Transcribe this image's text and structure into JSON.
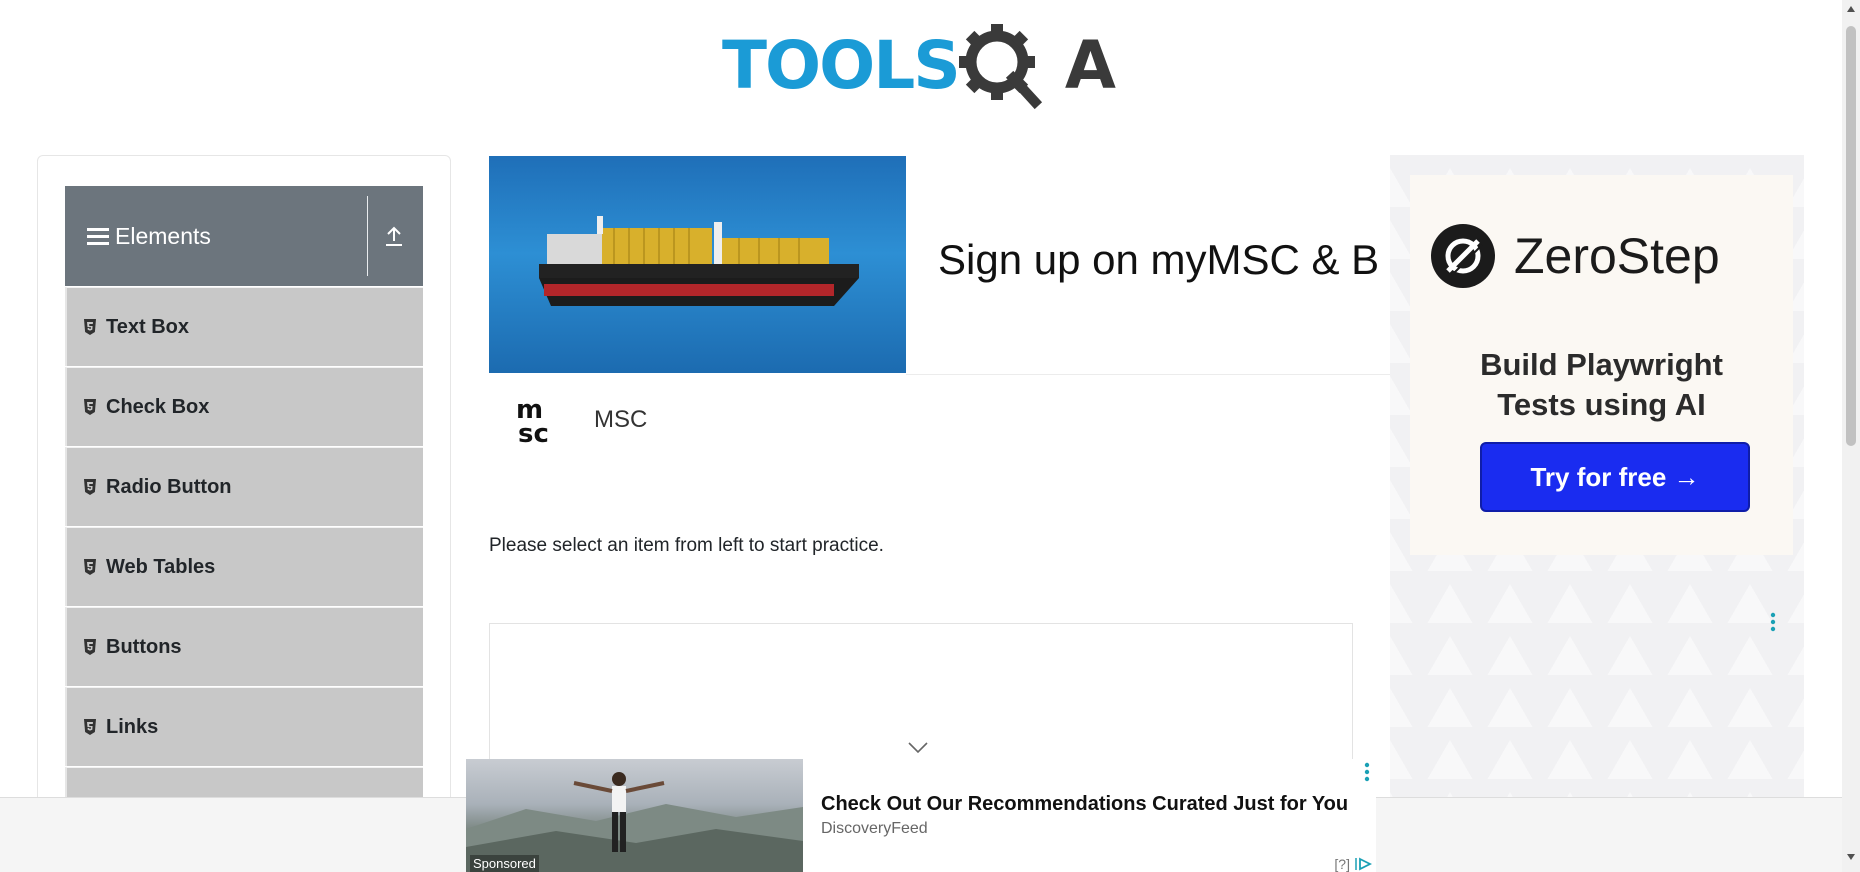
{
  "header": {
    "logo_text": "TOOLS",
    "logo_suffix": "A"
  },
  "sidebar": {
    "group_title": "Elements",
    "items": [
      {
        "label": "Text Box"
      },
      {
        "label": "Check Box"
      },
      {
        "label": "Radio Button"
      },
      {
        "label": "Web Tables"
      },
      {
        "label": "Buttons"
      },
      {
        "label": "Links"
      }
    ]
  },
  "top_ad": {
    "title": "Sign up on myMSC & B",
    "advertiser": "MSC"
  },
  "main": {
    "instruction": "Please select an item from left to start practice."
  },
  "right_ad": {
    "brand": "ZeroStep",
    "tagline_line1": "Build Playwright",
    "tagline_line2": "Tests using AI",
    "cta": "Try for free →"
  },
  "bottom_ad": {
    "headline": "Check Out Our Recommendations Curated Just for You",
    "source": "DiscoveryFeed",
    "sponsored": "Sponsored",
    "info": "[?]"
  },
  "colors": {
    "accent": "#1b9bd6",
    "sidebar_header": "#6c757d",
    "menu_item": "#c8c8c8",
    "cta": "#1a2cf0"
  }
}
